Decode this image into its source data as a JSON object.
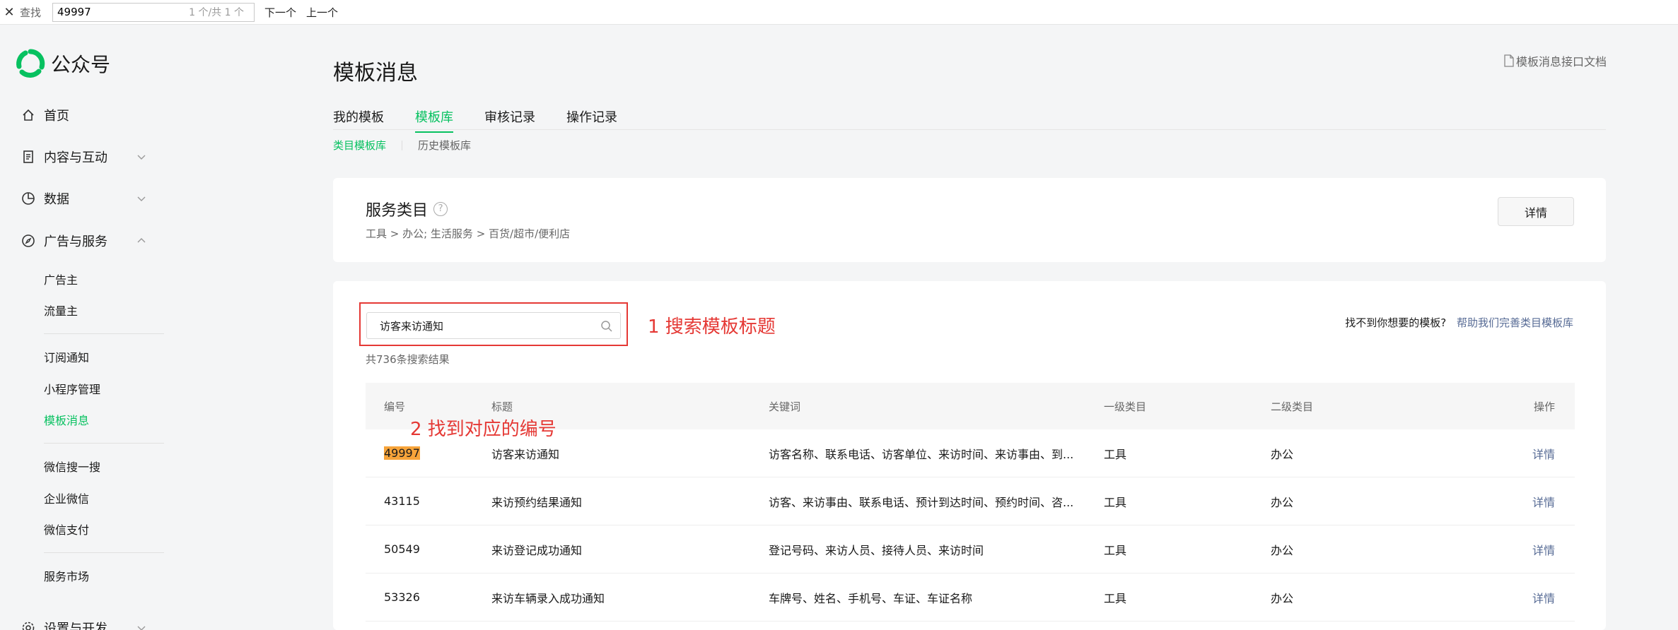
{
  "findbar": {
    "close": "✕",
    "label": "查找",
    "value": "49997",
    "count": "1 个/共 1 个",
    "next": "下一个",
    "prev": "上一个"
  },
  "brand": {
    "name": "公众号",
    "color": "#07c160"
  },
  "sidebar": {
    "items": [
      {
        "label": "首页",
        "icon": "home-icon"
      },
      {
        "label": "内容与互动",
        "icon": "document-icon"
      },
      {
        "label": "数据",
        "icon": "pie-chart-icon"
      },
      {
        "label": "广告与服务",
        "icon": "compass-icon"
      }
    ],
    "sub_items": [
      "广告主",
      "流量主",
      "订阅通知",
      "小程序管理",
      "模板消息",
      "微信搜一搜",
      "企业微信",
      "微信支付",
      "服务市场"
    ],
    "bottom_item": "设置与开发"
  },
  "main": {
    "title": "模板消息",
    "doc_link": "模板消息接口文档",
    "tabs": [
      "我的模板",
      "模板库",
      "审核记录",
      "操作记录"
    ],
    "subtabs": [
      "类目模板库",
      "历史模板库"
    ]
  },
  "category_card": {
    "title": "服务类目",
    "help": "?",
    "path": "工具 > 办公; 生活服务 > 百货/超市/便利店",
    "detail_button": "详情"
  },
  "search": {
    "value": "访客来访通知",
    "result_count": "共736条搜索结果",
    "notfound_text": "找不到你想要的模板?",
    "notfound_link": "帮助我们完善类目模板库"
  },
  "annotations": {
    "step1": "1 搜索模板标题",
    "step2": "2 找到对应的编号"
  },
  "table": {
    "headers": [
      "编号",
      "标题",
      "关键词",
      "一级类目",
      "二级类目",
      "操作"
    ],
    "rows": [
      {
        "id": "49997",
        "title": "访客来访通知",
        "keywords": "访客名称、联系电话、访客单位、来访时间、来访事由、到...",
        "cat1": "工具",
        "cat2": "办公",
        "action": "详情"
      },
      {
        "id": "43115",
        "title": "来访预约结果通知",
        "keywords": "访客、来访事由、联系电话、预计到达时间、预约时间、咨...",
        "cat1": "工具",
        "cat2": "办公",
        "action": "详情"
      },
      {
        "id": "50549",
        "title": "来访登记成功通知",
        "keywords": "登记号码、来访人员、接待人员、来访时间",
        "cat1": "工具",
        "cat2": "办公",
        "action": "详情"
      },
      {
        "id": "53326",
        "title": "来访车辆录入成功通知",
        "keywords": "车牌号、姓名、手机号、车证、车证名称",
        "cat1": "工具",
        "cat2": "办公",
        "action": "详情"
      }
    ]
  }
}
